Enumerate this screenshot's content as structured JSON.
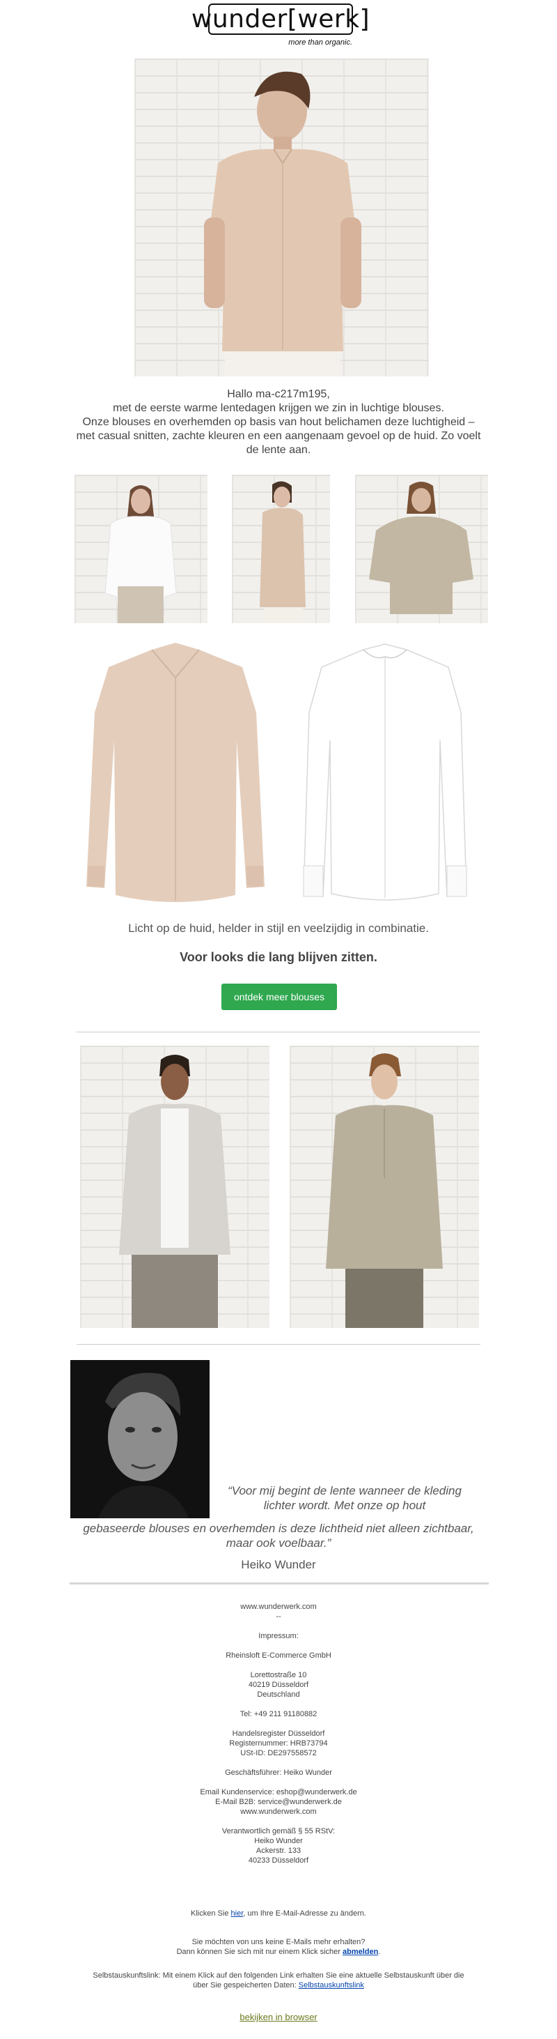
{
  "header": {
    "logo_text": "wunder[werk]",
    "tagline": "more than organic."
  },
  "intro": {
    "greeting": "Hallo ma-c217m195,",
    "lines": [
      "met de eerste warme lentedagen krijgen we zin in luchtige blouses.",
      "Onze blouses en overhemden op basis van hout belichamen deze luchtigheid –",
      "met casual snitten, zachte kleuren en een aangenaam gevoel op de huid. Zo voelt",
      "de lente aan."
    ]
  },
  "women_section": {
    "subline": "Licht op de huid, helder in stijl en veelzijdig in combinatie.",
    "headline": "Voor looks die lang blijven zitten.",
    "cta_label": "ontdek meer blouses"
  },
  "quote": {
    "line1": "“Voor mij begint de lente wanneer de kleding",
    "line2": "lichter wordt. Met onze op hout",
    "line3": "gebaseerde blouses en overhemden is deze lichtheid niet alleen zichtbaar,",
    "line4": "maar ook voelbaar.”",
    "author": "Heiko Wunder"
  },
  "footer": {
    "website": "www.wunderwerk.com",
    "dashes": "--",
    "impressum_title": "Impressum:",
    "company": "Rheinsloft E-Commerce GmbH",
    "address": [
      "Lorettostraße 10",
      "40219 Düsseldorf",
      "Deutschland"
    ],
    "phone": "Tel: +49 211 91180882",
    "register": [
      "Handelsregister Düsseldorf",
      "Registernummer: HRB73794",
      "USt-ID: DE297558572"
    ],
    "ceo": "Geschäftsführer: Heiko Wunder",
    "contact": [
      "Email Kundenservice: eshop@wunderwerk.de",
      "E-Mail B2B: service@wunderwerk.de",
      "www.wunderwerk.com"
    ],
    "responsible": [
      "Verantwortlich gemäß § 55 RStV:",
      "Heiko Wunder",
      "Ackerstr. 133",
      "40233 Düsseldorf"
    ],
    "change_prefix": "Klicken Sie ",
    "change_link": "hier",
    "change_suffix": ", um Ihre E-Mail-Adresse zu ändern.",
    "unsub_line1": "Sie möchten von uns keine E-Mails mehr erhalten?",
    "unsub_prefix": "Dann können Sie sich mit nur einem Klick sicher ",
    "unsub_link": "abmelden",
    "unsub_suffix": ".",
    "selfinfo_line1": "Selbstauskunftslink: Mit einem Klick auf den folgenden Link erhalten Sie eine aktuelle Selbstauskunft über die",
    "selfinfo_prefix": "über Sie gespeicherten Daten: ",
    "selfinfo_link": "Selbstauskunftslink",
    "browser_link": "bekijken in browser"
  },
  "colors": {
    "cta_green": "#2fa84f",
    "link_blue": "#0645ad",
    "browser_link_olive": "#6b7a1e"
  }
}
